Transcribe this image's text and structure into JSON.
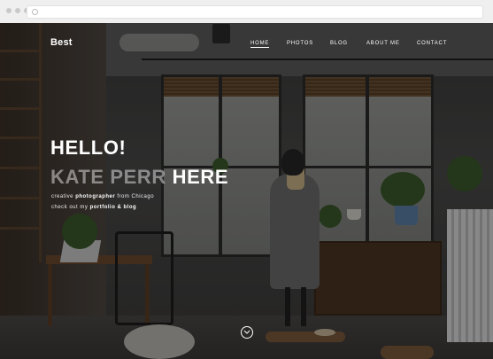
{
  "site": {
    "brand": "Best"
  },
  "nav": {
    "items": [
      {
        "label": "HOME",
        "active": true
      },
      {
        "label": "PHOTOS",
        "active": false
      },
      {
        "label": "BLOG",
        "active": false
      },
      {
        "label": "ABOUT ME",
        "active": false
      },
      {
        "label": "CONTACT",
        "active": false
      }
    ]
  },
  "hero": {
    "greeting": "HELLO!",
    "name_part": "KATE PERR",
    "name_rest": "HERE",
    "line1_prefix": "creative",
    "line1_bold": "photographer",
    "line1_suffix": "from Chicago",
    "line2_prefix": "check out my",
    "line2_bold": "portfolio & blog"
  },
  "icons": {
    "scroll": "chevron-down-icon"
  },
  "colors": {
    "text": "#ffffff",
    "overlay": "rgba(0,0,0,0.38)"
  }
}
